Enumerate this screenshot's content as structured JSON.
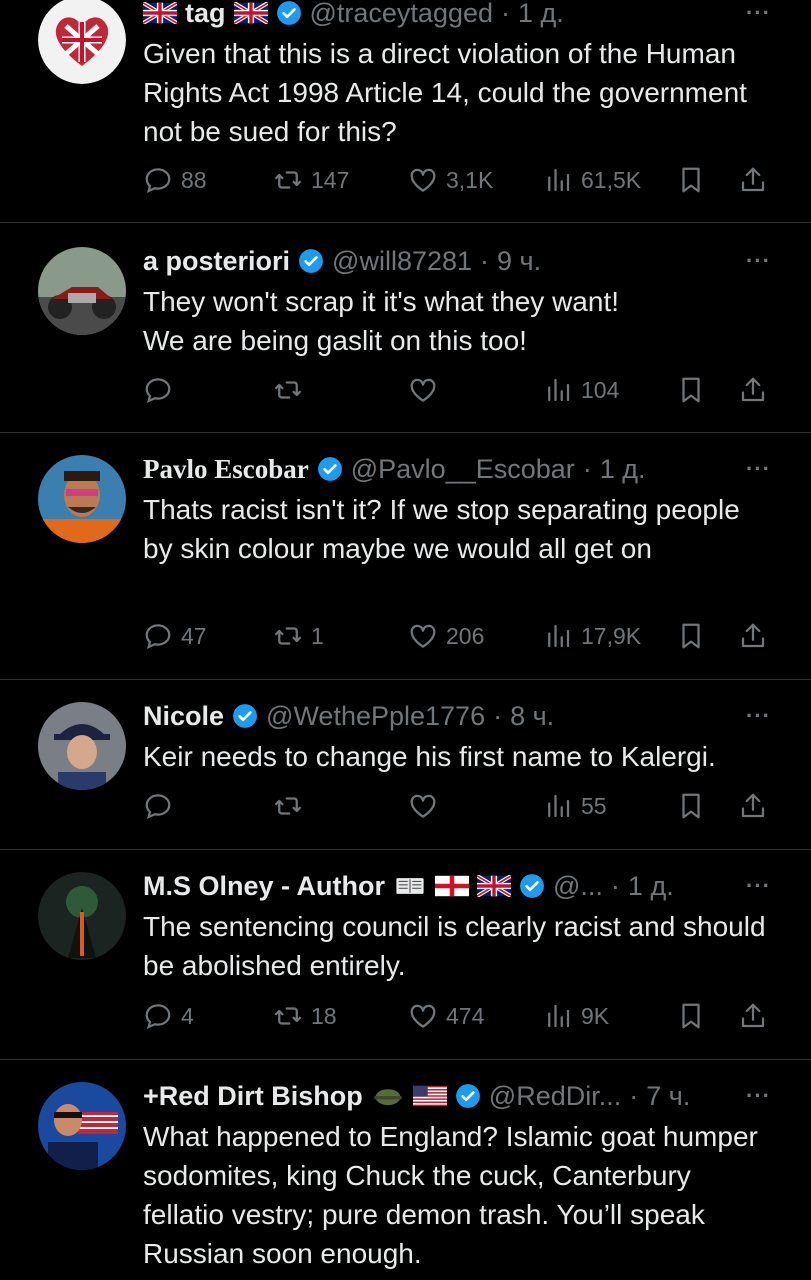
{
  "tweets": [
    {
      "name": "tag",
      "handle": "@traceytagged",
      "time": "1 д.",
      "text": "Given that this is a direct violation of the Human Rights Act 1998 Article 14, could the government not be sued for this?",
      "replies": "88",
      "reposts": "147",
      "likes": "3,1K",
      "views": "61,5K"
    },
    {
      "name": "a posteriori",
      "handle": "@will87281",
      "time": "9 ч.",
      "text_lines": [
        "They won't scrap it it's what they want!",
        "We are being gaslit on this too!"
      ],
      "replies": "",
      "reposts": "",
      "likes": "",
      "views": "104"
    },
    {
      "name": "Pavlo Escobar",
      "handle": "@Pavlo__Escobar",
      "time": "1 д.",
      "text": "Thats racist isn't it?  If we stop separating people by skin colour maybe we would all get on",
      "replies": "47",
      "reposts": "1",
      "likes": "206",
      "views": "17,9K"
    },
    {
      "name": "Nicole",
      "handle": "@WethePple1776",
      "time": "8 ч.",
      "text": "Keir needs to change his first name to Kalergi.",
      "replies": "",
      "reposts": "",
      "likes": "",
      "views": "55"
    },
    {
      "name": "M.S Olney - Author",
      "handle": "@...",
      "time": "1 д.",
      "text": "The sentencing council is clearly racist and should be abolished entirely.",
      "replies": "4",
      "reposts": "18",
      "likes": "474",
      "views": "9K"
    },
    {
      "name": "+Red Dirt Bishop",
      "handle": "@RedDir...",
      "time": "7 ч.",
      "text": "What happened to England? Islamic goat humper sodomites, king Chuck the cuck, Canterbury fellatio vestry; pure demon trash. You’ll speak Russian soon enough."
    }
  ],
  "separator": "·",
  "more": "···",
  "colors": {
    "background": "#000000",
    "text": "#e7e9ea",
    "muted": "#71767b",
    "verified": "#1d9bf0",
    "divider": "#2f3336"
  },
  "icons": [
    "reply-icon",
    "repost-icon",
    "like-icon",
    "views-icon",
    "bookmark-icon",
    "share-icon",
    "verified-badge-icon",
    "more-icon"
  ]
}
